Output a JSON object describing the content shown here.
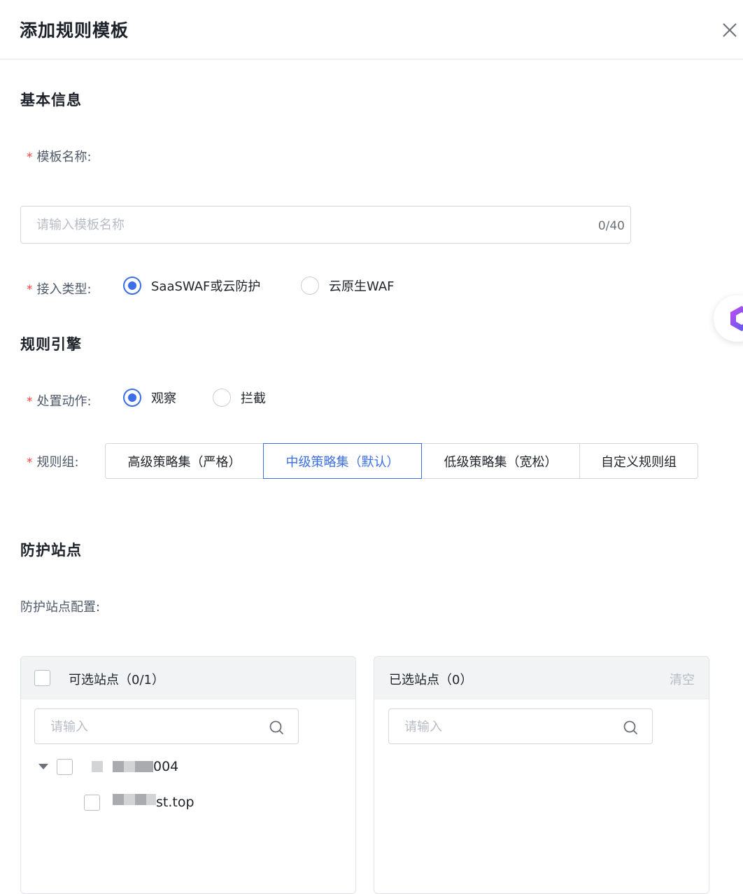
{
  "dialog": {
    "title": "添加规则模板",
    "close_icon": "close-icon"
  },
  "sections": {
    "basic": "基本信息",
    "engine": "规则引擎",
    "sites": "防护站点"
  },
  "required_mark": "*",
  "template_name": {
    "label": "模板名称:",
    "placeholder": "请输入模板名称",
    "value": "",
    "counter": "0/40"
  },
  "access_type": {
    "label": "接入类型:",
    "options": [
      {
        "label": "SaaSWAF或云防护",
        "checked": true
      },
      {
        "label": "云原生WAF",
        "checked": false
      }
    ]
  },
  "action": {
    "label": "处置动作:",
    "options": [
      {
        "label": "观察",
        "checked": true
      },
      {
        "label": "拦截",
        "checked": false
      }
    ]
  },
  "rule_group": {
    "label": "规则组:",
    "options": [
      {
        "label": "高级策略集（严格）",
        "active": false
      },
      {
        "label": "中级策略集（默认）",
        "active": true
      },
      {
        "label": "低级策略集（宽松）",
        "active": false
      },
      {
        "label": "自定义规则组",
        "active": false
      }
    ]
  },
  "site_config": {
    "label": "防护站点配置:",
    "available": {
      "title": "可选站点（0/1）",
      "search_placeholder": "请输入",
      "tree": [
        {
          "text": "004",
          "children": [
            {
              "text": "st.top"
            }
          ]
        }
      ]
    },
    "selected": {
      "title": "已选站点（0）",
      "clear": "清空",
      "search_placeholder": "请输入"
    }
  },
  "colors": {
    "primary": "#3b6ee8",
    "required": "#f53f3f",
    "border": "#d4d7de",
    "placeholder": "#b8bcc4"
  },
  "side_widget_icon": "assistant-logo-icon"
}
